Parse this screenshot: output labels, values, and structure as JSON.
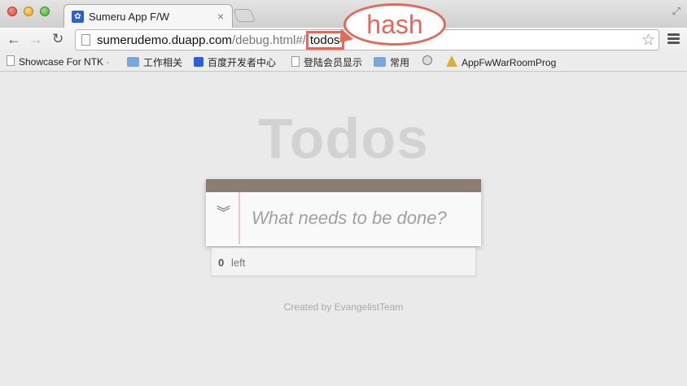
{
  "browser": {
    "tab": {
      "title": "Sumeru App F/W",
      "close": "×"
    },
    "url": {
      "host": "sumerudemo.duapp.com",
      "path": "/debug.html#/",
      "hash": "todos"
    },
    "callout": "hash",
    "bookmarks": [
      {
        "label": "Showcase For NTK",
        "fade": " -",
        "icon": "page-icon"
      },
      {
        "label": "工作相关",
        "icon": "folder-icon"
      },
      {
        "label": "百度开发者中心",
        "icon": "paw-icon"
      },
      {
        "label": "登陆会员显示",
        "icon": "page-icon"
      },
      {
        "label": "常用",
        "icon": "folder-icon"
      },
      {
        "label": "",
        "icon": "globe-icon"
      },
      {
        "label": "AppFwWarRoomProg",
        "icon": "warning-icon"
      }
    ]
  },
  "app": {
    "title": "Todos",
    "input_placeholder": "What needs to be done?",
    "toggle_icon": "»",
    "count": "0",
    "count_label": "left",
    "credit": "Created by EvangelistTeam"
  },
  "colors": {
    "accent": "#e26a5a",
    "header": "#8c7d74",
    "title": "#d2d2d2"
  }
}
